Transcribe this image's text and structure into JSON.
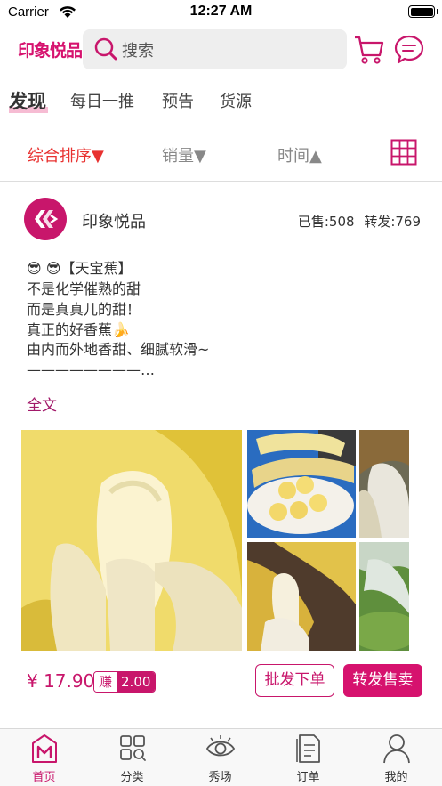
{
  "status_bar": {
    "carrier": "Carrier",
    "time": "12:27 AM"
  },
  "header": {
    "logo": "印象悦品",
    "search_placeholder": "搜索"
  },
  "tabs": [
    {
      "label": "发现",
      "active": true
    },
    {
      "label": "每日一推",
      "active": false
    },
    {
      "label": "预告",
      "active": false
    },
    {
      "label": "货源",
      "active": false
    }
  ],
  "sort": {
    "comprehensive": "综合排序▼",
    "sales": "销量▼",
    "time": "时间▲"
  },
  "post": {
    "shop_name": "印象悦品",
    "sold": "已售:508",
    "forwarded": "转发:769",
    "lines": [
      "😎 😎【天宝蕉】",
      "不是化学催熟的甜",
      "而是真真儿的甜！",
      "真正的好香蕉🍌",
      "由内而外地香甜、细腻软滑~",
      "————————…"
    ],
    "fulltext": "全文",
    "price": "¥ 17.90",
    "earn_label": "赚",
    "earn_value": "2.00",
    "batch_order": "批发下单",
    "forward_sell": "转发售卖"
  },
  "bottom_tabs": [
    {
      "label": "首页",
      "icon": "home-m-icon",
      "active": true
    },
    {
      "label": "分类",
      "icon": "category-grid-icon",
      "active": false
    },
    {
      "label": "秀场",
      "icon": "eye-icon",
      "active": false
    },
    {
      "label": "订单",
      "icon": "order-list-icon",
      "active": false
    },
    {
      "label": "我的",
      "icon": "person-icon",
      "active": false
    }
  ],
  "colors": {
    "brand": "#d6126e",
    "sort_active": "#e8312f",
    "tab_highlight": "#f6bcd3"
  }
}
